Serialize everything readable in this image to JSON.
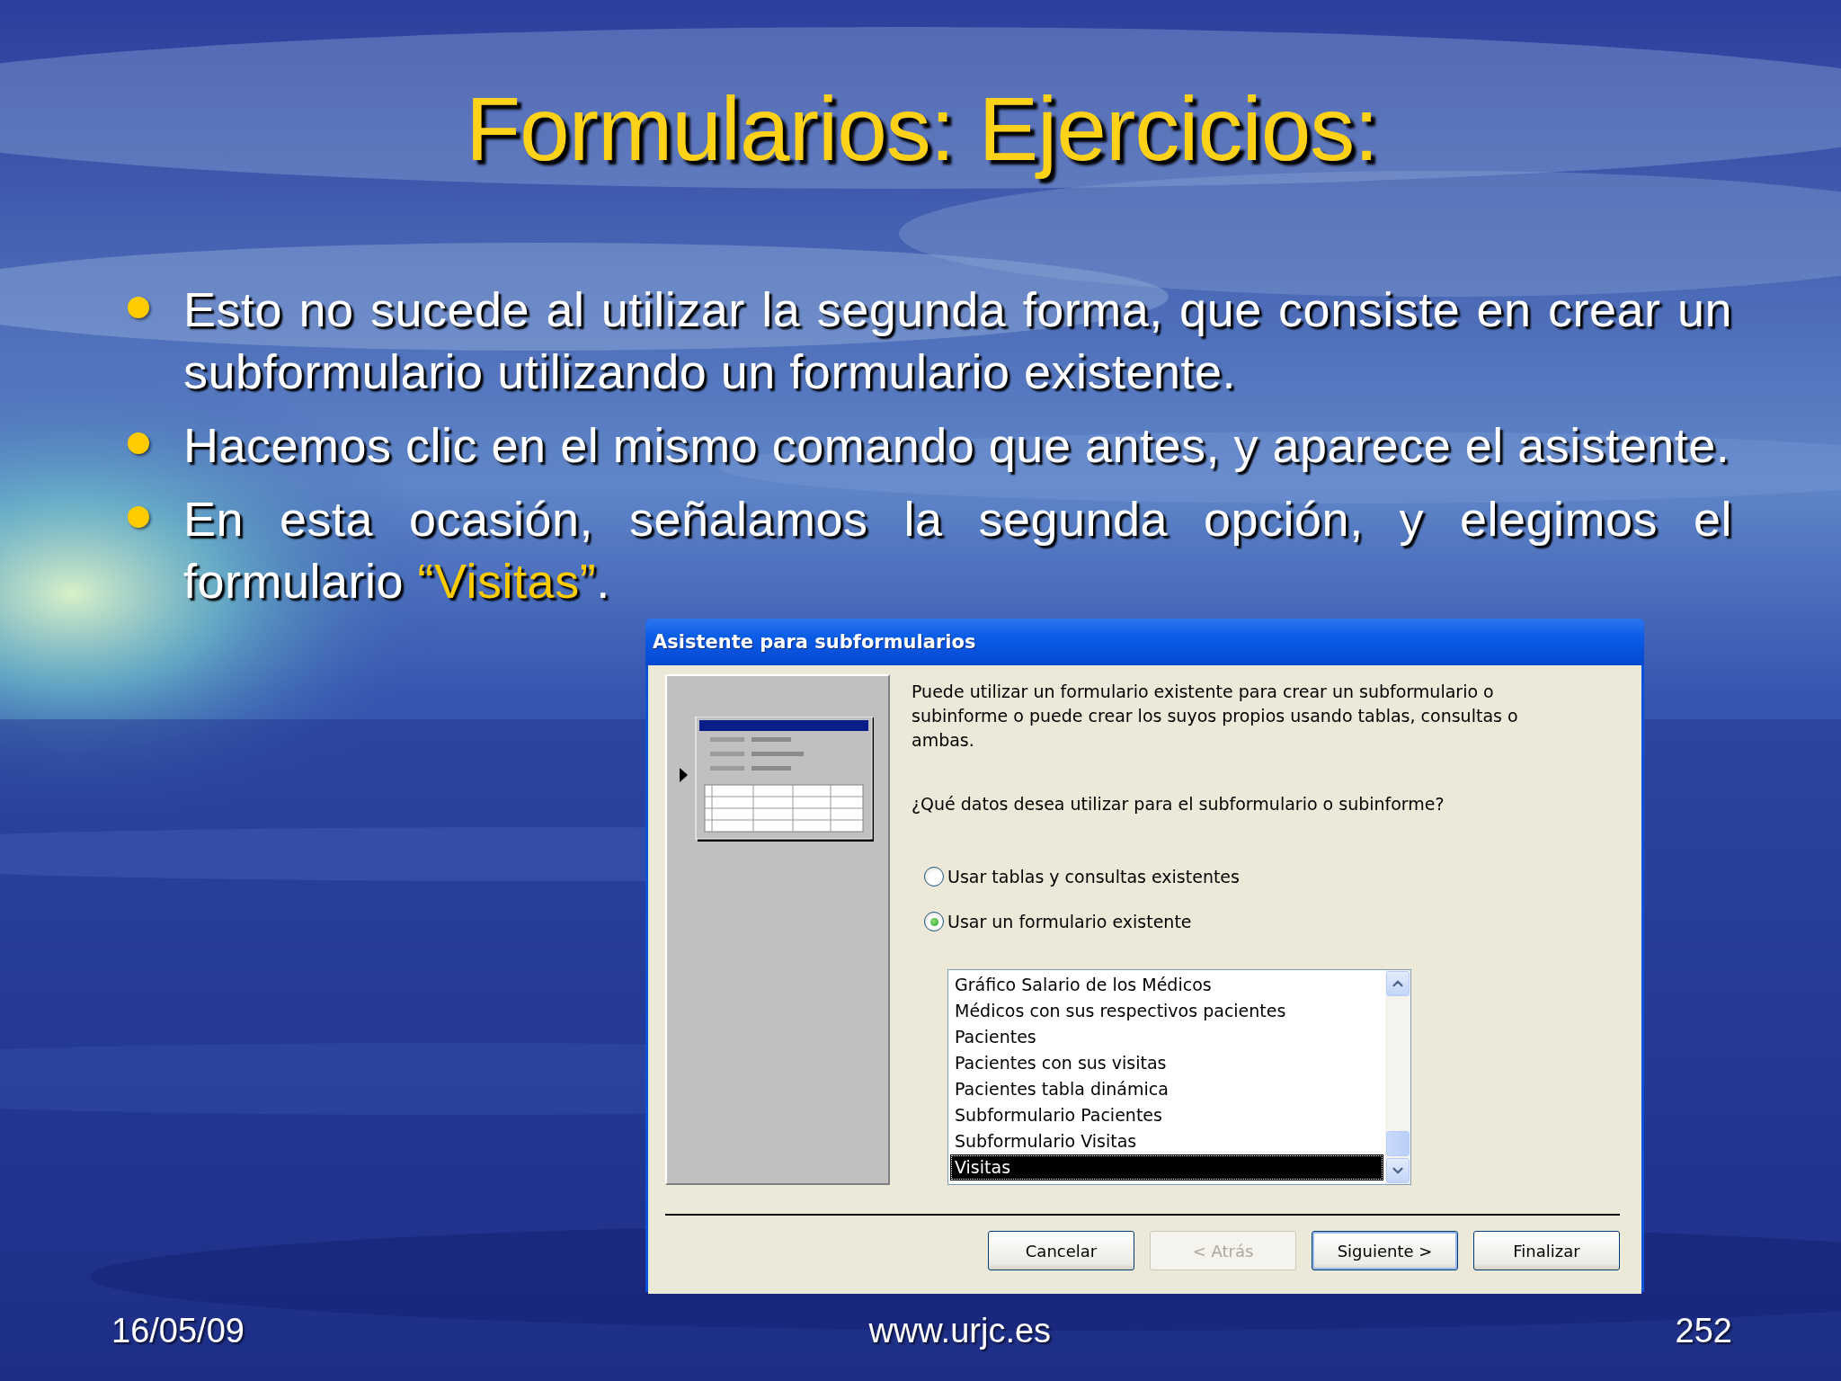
{
  "slide": {
    "title": "Formularios: Ejercicios:",
    "bullets": [
      {
        "segments": [
          {
            "text": "Esto no sucede al utilizar la segunda forma, que consiste en crear un subformulario utilizando un formulario existente.",
            "highlight": false
          }
        ]
      },
      {
        "segments": [
          {
            "text": "Hacemos clic en el mismo comando que antes, y aparece el asistente.",
            "highlight": false
          }
        ]
      },
      {
        "segments": [
          {
            "text": "En esta ocasión, señalamos la segunda opción, y elegimos el formulario ",
            "highlight": false
          },
          {
            "text": "“Visitas”",
            "highlight": true
          },
          {
            "text": ".",
            "highlight": false
          }
        ]
      }
    ],
    "footer": {
      "date": "16/05/09",
      "url": "www.urjc.es",
      "page": "252"
    }
  },
  "dialog": {
    "title": "Asistente para subformularios",
    "description": "Puede utilizar un formulario existente para crear un subformulario o subinforme o puede crear los suyos propios usando tablas, consultas o ambas.",
    "question": "¿Qué datos desea utilizar para el subformulario o subinforme?",
    "options": [
      {
        "label": "Usar tablas y consultas existentes",
        "selected": false
      },
      {
        "label": "Usar un formulario existente",
        "selected": true
      }
    ],
    "forms": [
      {
        "label": "Gráfico Salario de los Médicos",
        "selected": false
      },
      {
        "label": "Médicos con sus respectivos pacientes",
        "selected": false
      },
      {
        "label": "Pacientes",
        "selected": false
      },
      {
        "label": "Pacientes con sus visitas",
        "selected": false
      },
      {
        "label": "Pacientes tabla dinámica",
        "selected": false
      },
      {
        "label": "Subformulario Pacientes",
        "selected": false
      },
      {
        "label": "Subformulario Visitas",
        "selected": false
      },
      {
        "label": "Visitas",
        "selected": true
      }
    ],
    "buttons": [
      {
        "label": "Cancelar",
        "disabled": false,
        "default": false
      },
      {
        "label": "< Atrás",
        "disabled": true,
        "default": false
      },
      {
        "label": "Siguiente >",
        "disabled": false,
        "default": true
      },
      {
        "label": "Finalizar",
        "disabled": false,
        "default": false
      }
    ]
  }
}
